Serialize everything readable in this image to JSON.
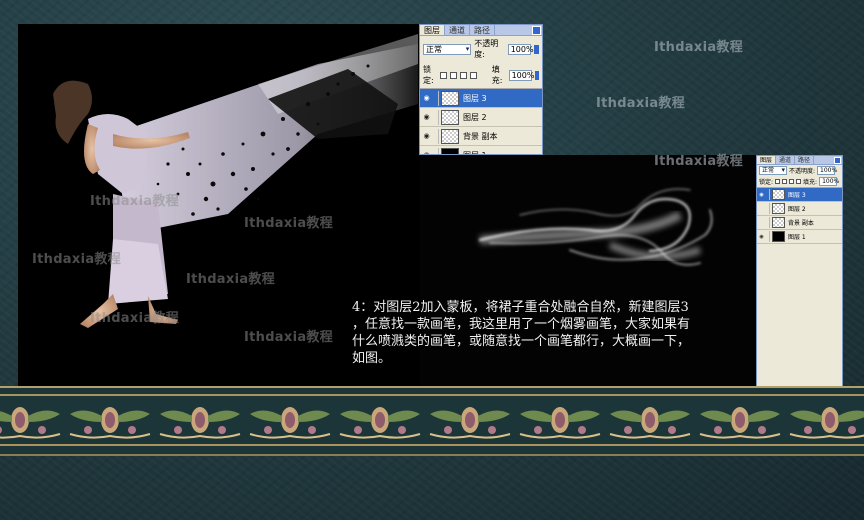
{
  "watermark": "Ithdaxia教程",
  "layers_panel": {
    "tabs": [
      "图层",
      "通道",
      "路径"
    ],
    "blend_mode": "正常",
    "opacity_label": "不透明度:",
    "opacity_value": "100%",
    "lock_label": "锁定:",
    "fill_label": "填充:",
    "fill_value": "100%",
    "layers": [
      {
        "name": "图层 3",
        "thumb": "checker",
        "visible": true,
        "active": true
      },
      {
        "name": "图层 2",
        "thumb": "checker",
        "visible": true,
        "active": false
      },
      {
        "name": "背景 副本",
        "thumb": "checker",
        "visible": true,
        "active": false
      },
      {
        "name": "图层 1",
        "thumb": "black",
        "visible": true,
        "active": false
      }
    ]
  },
  "instruction_text": "4：对图层2加入蒙板，将裙子重合处融合自然，新建图层3\n，任意找一款画笔，我这里用了一个烟雾画笔，大家如果有\n什么喷溅类的画笔，或随意找一个画笔都行，大概画一下，\n如图。",
  "colors": {
    "page_bg": "#223c42",
    "panel_bg": "#ece9d8",
    "selected_layer": "#316ac5",
    "ornament_gold": "#a9925b"
  },
  "icons": [
    "eye-icon",
    "lock-icon",
    "brush-icon",
    "chain-icon",
    "panel-menu-icon"
  ]
}
